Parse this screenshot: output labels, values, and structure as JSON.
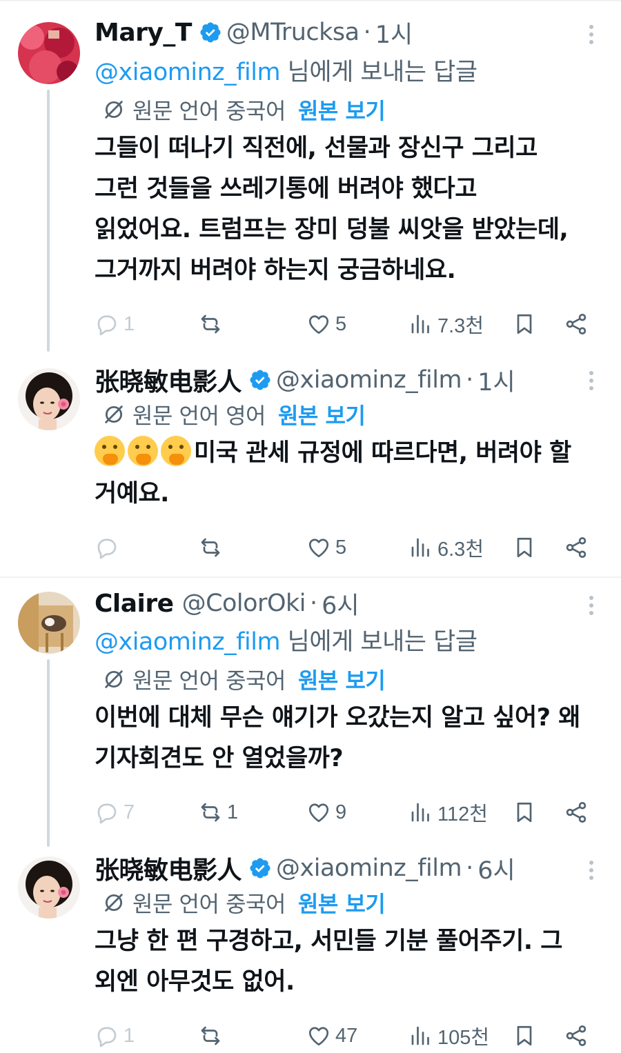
{
  "tweets": [
    {
      "name": "Mary_T",
      "verified": true,
      "handle": "@MTrucksa",
      "separator": "·",
      "time": "1시",
      "reply_mention": "@xiaominz_film",
      "reply_suffix": " 님에게 보내는 답글",
      "translate_lang": "원문 언어 중국어",
      "translate_link": "원본 보기",
      "lines": [
        "그들이 떠나기 직전에, 선물과 장신구 그리고",
        "그런 것들을 쓰레기통에 버려야 했다고",
        "읽었어요. 트럼프는 장미 덩불 씨앗을 받았는데,",
        "그거까지 버려야 하는지 궁금하네요."
      ],
      "replies": "1",
      "retweets": "",
      "likes": "5",
      "views": "7.3천"
    },
    {
      "name": "张晓敏电影人",
      "verified": true,
      "handle": "@xiaominz_film",
      "separator": "·",
      "time": "1시",
      "translate_lang": "원문 언어 영어",
      "translate_link": "원본 보기",
      "emoji_prefix": "🤭🤭🤭",
      "lines": [
        "미국 관세 규정에 따르다면, 버려야 할",
        "거예요."
      ],
      "replies": "",
      "retweets": "",
      "likes": "5",
      "views": "6.3천"
    },
    {
      "name": "Claire",
      "verified": false,
      "handle": "@ColorOki",
      "separator": "·",
      "time": "6시",
      "reply_mention": "@xiaominz_film",
      "reply_suffix": " 님에게 보내는 답글",
      "translate_lang": "원문 언어 중국어",
      "translate_link": "원본 보기",
      "lines": [
        "이번에 대체 무슨 얘기가 오갔는지 알고 싶어? 왜",
        "기자회견도 안 열었을까?"
      ],
      "replies": "7",
      "retweets": "1",
      "likes": "9",
      "views": "112천"
    },
    {
      "name": "张晓敏电影人",
      "verified": true,
      "handle": "@xiaominz_film",
      "separator": "·",
      "time": "6시",
      "translate_lang": "원문 언어 중국어",
      "translate_link": "원본 보기",
      "lines": [
        "그냥 한 편 구경하고, 서민들 기분 풀어주기. 그",
        "외엔 아무것도 없어."
      ],
      "replies": "1",
      "retweets": "",
      "likes": "47",
      "views": "105천"
    }
  ],
  "colors": {
    "accent": "#1d9bf0",
    "text": "#0f1419",
    "secondary": "#536471",
    "thread_line": "#cfd9de"
  },
  "icons": [
    "verified-badge-icon",
    "translate-icon",
    "reply-icon",
    "retweet-icon",
    "like-icon",
    "views-icon",
    "bookmark-icon",
    "share-icon",
    "more-icon"
  ]
}
